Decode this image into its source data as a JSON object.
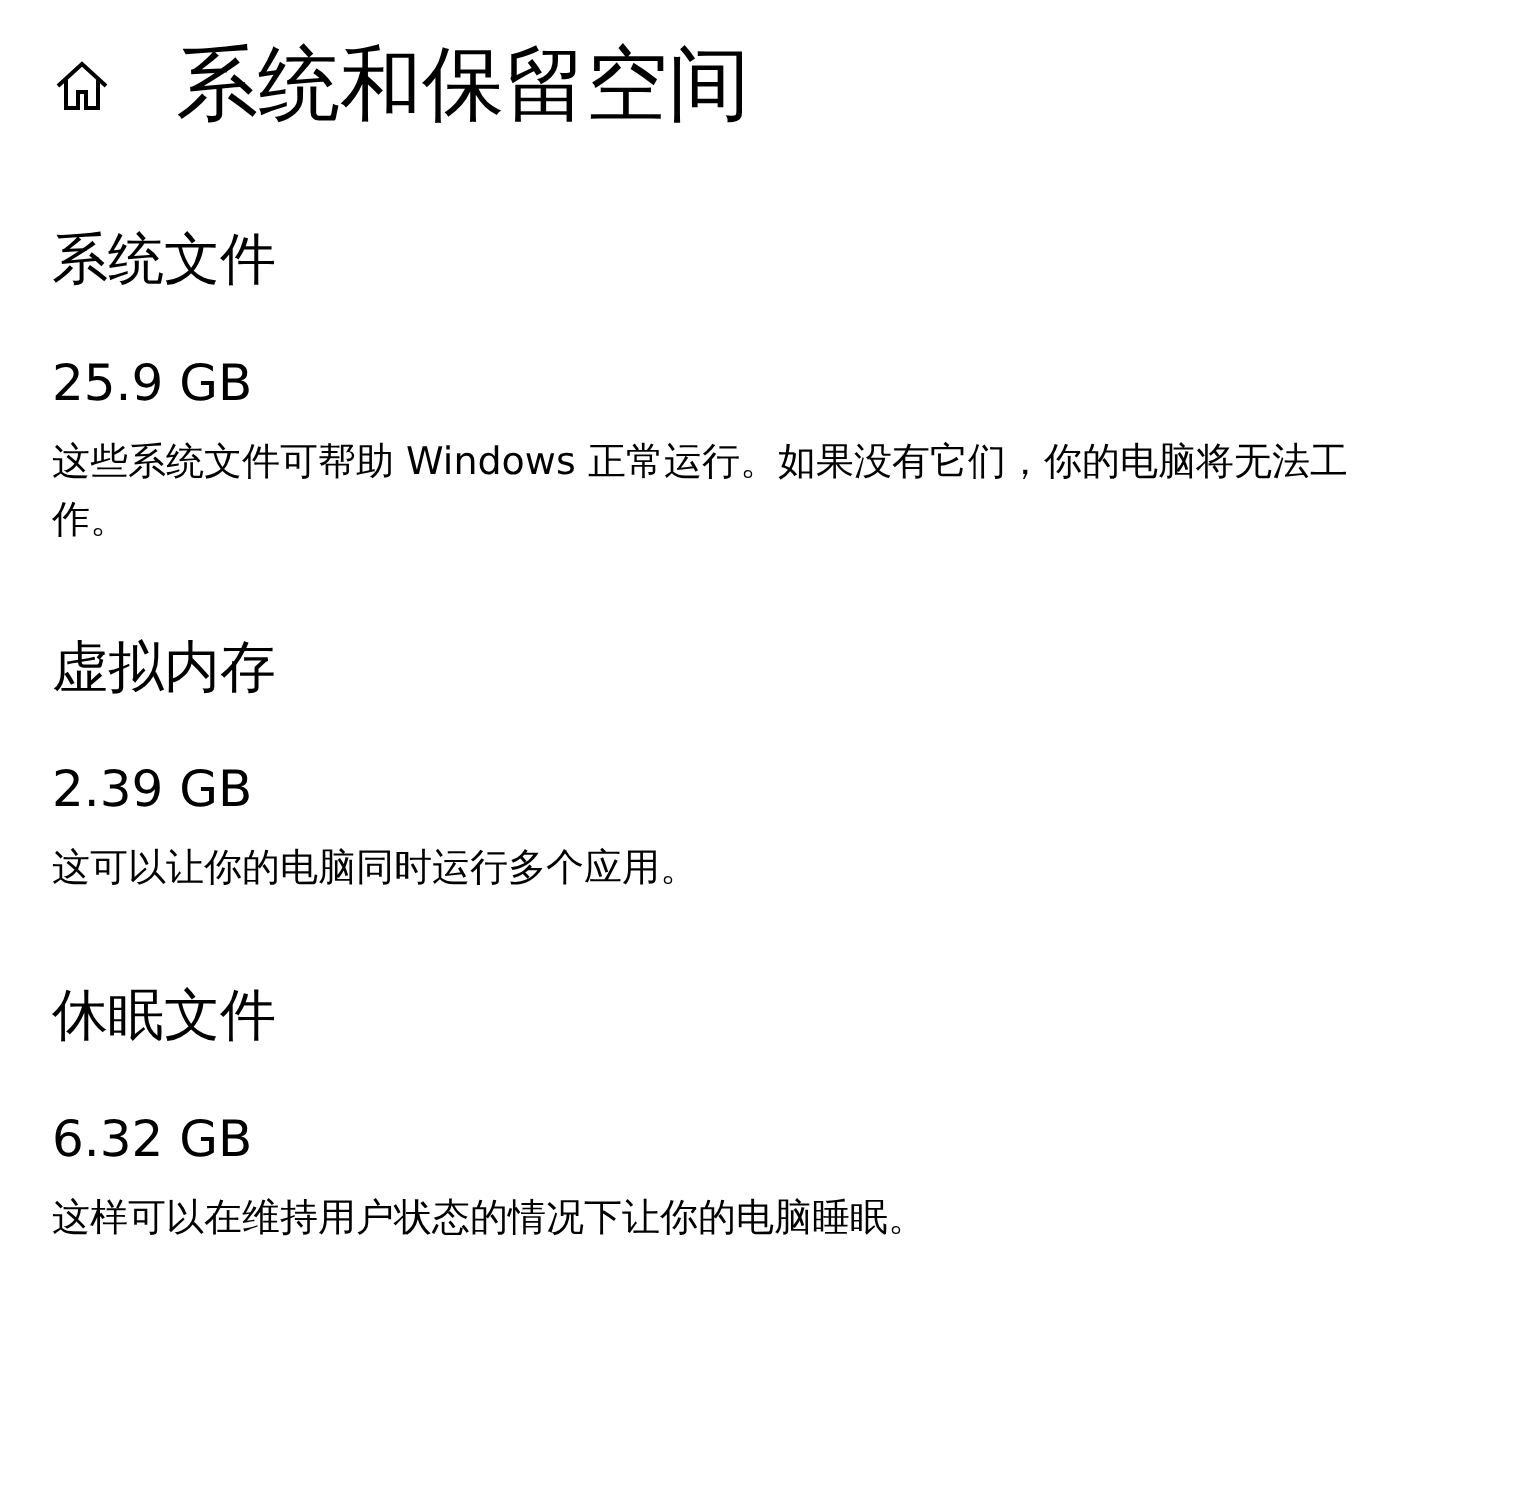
{
  "title": "系统和保留空间",
  "sections": [
    {
      "heading": "系统文件",
      "size": "25.9 GB",
      "description": "这些系统文件可帮助 Windows 正常运行。如果没有它们，你的电脑将无法工作。"
    },
    {
      "heading": "虚拟内存",
      "size": "2.39 GB",
      "description": "这可以让你的电脑同时运行多个应用。"
    },
    {
      "heading": "休眠文件",
      "size": "6.32 GB",
      "description": "这样可以在维持用户状态的情况下让你的电脑睡眠。"
    }
  ]
}
